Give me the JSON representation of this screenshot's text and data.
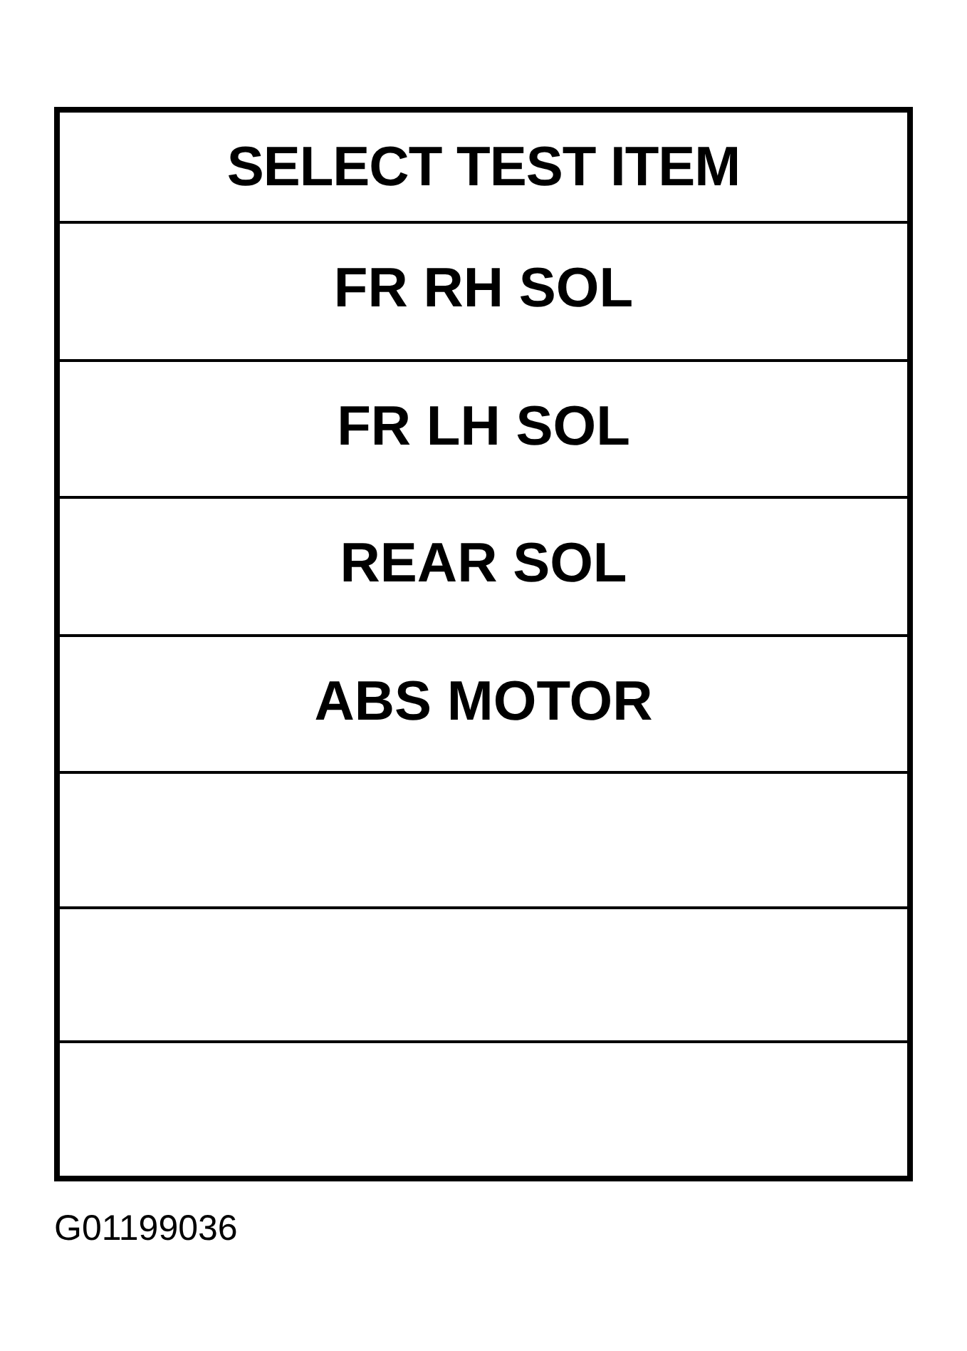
{
  "menu": {
    "title": "SELECT TEST ITEM",
    "rows": [
      {
        "kind": "item",
        "label": "FR RH SOL"
      },
      {
        "kind": "item",
        "label": "FR LH SOL"
      },
      {
        "kind": "item",
        "label": "REAR SOL"
      },
      {
        "kind": "item",
        "label": "ABS MOTOR"
      },
      {
        "kind": "blank"
      },
      {
        "kind": "blank"
      },
      {
        "kind": "blank"
      }
    ]
  },
  "figure_id": "G01199036"
}
